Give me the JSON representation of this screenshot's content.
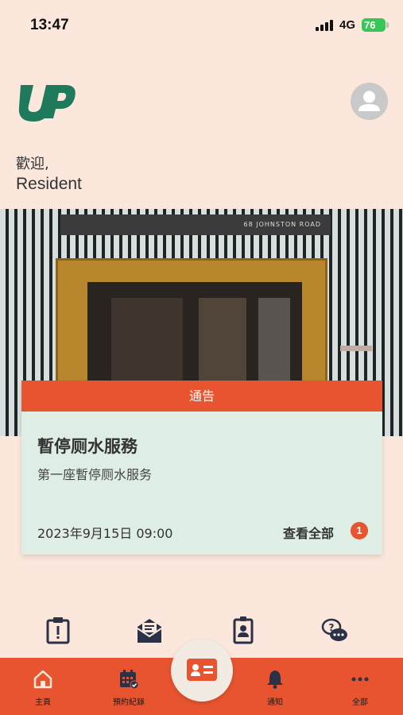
{
  "status_bar": {
    "time": "13:47",
    "network": "4G",
    "battery": "76"
  },
  "greeting": {
    "welcome": "歡迎,",
    "user": "Resident"
  },
  "hero": {
    "sign_text": "68 JOHNSTON ROAD"
  },
  "notice": {
    "header": "通告",
    "title": "暫停厕水服務",
    "body": "第一座暫停厕水服务",
    "date": "2023年9月15日 09:00",
    "view_all": "查看全部",
    "count": "1"
  },
  "quick_actions": [
    "report-icon",
    "mail-icon",
    "id-badge-icon",
    "chat-help-icon"
  ],
  "tabs": [
    {
      "label": "主頁",
      "icon": "home-icon"
    },
    {
      "label": "預約紀錄",
      "icon": "calendar-check-icon"
    },
    {
      "label": "通知",
      "icon": "bell-icon"
    },
    {
      "label": "全部",
      "icon": "more-icon"
    }
  ],
  "colors": {
    "accent": "#e8542f",
    "background": "#fbe7dc",
    "card": "#dfeee5",
    "brand_green": "#1f7a5c",
    "icon_navy": "#2b3147"
  }
}
